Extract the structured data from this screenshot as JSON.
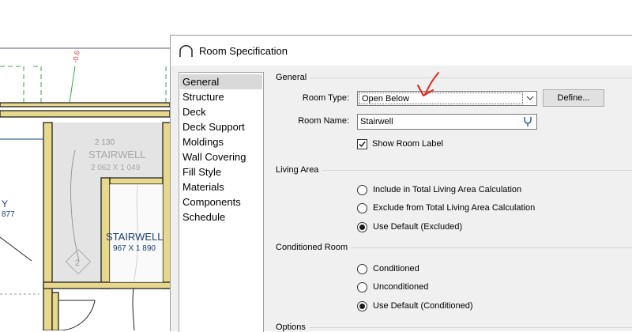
{
  "drawing": {
    "elevation_label": "-0.6",
    "stair_label_gray": "STAIRWELL",
    "stair_dims_gray": "2 062 X 1 049",
    "stair_extra_gray": "2 130",
    "stair_label_blue": "STAIRWELL",
    "stair_dims_blue": "967 X 1 890",
    "left_label": "Y",
    "left_dims": "877",
    "stair_number": "2"
  },
  "dialog": {
    "title": "Room Specification",
    "nav": [
      "General",
      "Structure",
      "Deck",
      "Deck Support",
      "Moldings",
      "Wall Covering",
      "Fill Style",
      "Materials",
      "Components",
      "Schedule"
    ],
    "nav_selected": "General",
    "general": {
      "group_title": "General",
      "room_type_label": "Room Type:",
      "room_type_value": "Open Below",
      "define_button": "Define...",
      "room_name_label": "Room Name:",
      "room_name_value": "Stairwell",
      "show_label_checkbox": "Show Room Label",
      "show_label_checked": true
    },
    "living_area": {
      "group_title": "Living Area",
      "options": [
        "Include in Total Living Area Calculation",
        "Exclude from Total Living Area Calculation",
        "Use Default (Excluded)"
      ],
      "selected_index": 2
    },
    "conditioned": {
      "group_title": "Conditioned Room",
      "options": [
        "Conditioned",
        "Unconditioned",
        "Use Default (Conditioned)"
      ],
      "selected_index": 2
    },
    "options": {
      "group_title": "Options"
    }
  },
  "colors": {
    "wall_fill": "#e8d88c",
    "wall_outline": "#222222",
    "stair_label_blue": "#1a3f7a",
    "annotation_red": "#e0261d",
    "elevation_red": "#d9332b",
    "guide_green": "#3fa34d",
    "selected_nav_bg": "#d9d9d9"
  }
}
